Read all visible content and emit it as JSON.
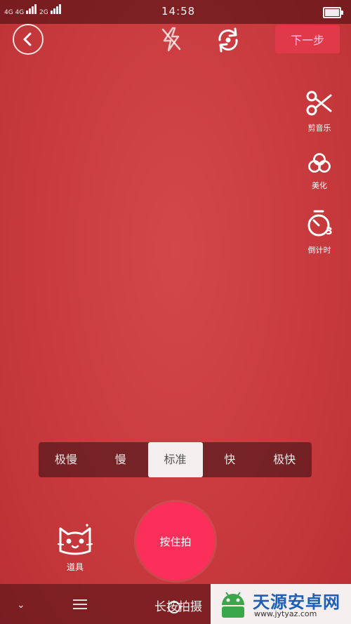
{
  "status_bar": {
    "network_1": "4G",
    "network_2": "4G",
    "network_3": "2G",
    "time": "14:58",
    "battery_level": 0.9
  },
  "top_bar": {
    "next_label": "下一步"
  },
  "side_tools": [
    {
      "icon": "scissors-icon",
      "label": "剪音乐"
    },
    {
      "icon": "beautify-icon",
      "label": "美化"
    },
    {
      "icon": "timer-icon",
      "label": "倒计时",
      "badge": "3"
    }
  ],
  "speed_options": {
    "items": [
      "极慢",
      "慢",
      "标准",
      "快",
      "极快"
    ],
    "selected": "标准"
  },
  "props": {
    "label": "道具"
  },
  "record": {
    "label": "按住拍"
  },
  "nav": {
    "hint": "长按拍摄"
  },
  "watermark": {
    "title": "天源安卓网",
    "url": "www.jytyaz.com",
    "brand_color": "#1c5fb5"
  },
  "colors": {
    "background": "#c83a3d",
    "record_button": "#fb2f59",
    "next_button": "#e03a4a"
  }
}
